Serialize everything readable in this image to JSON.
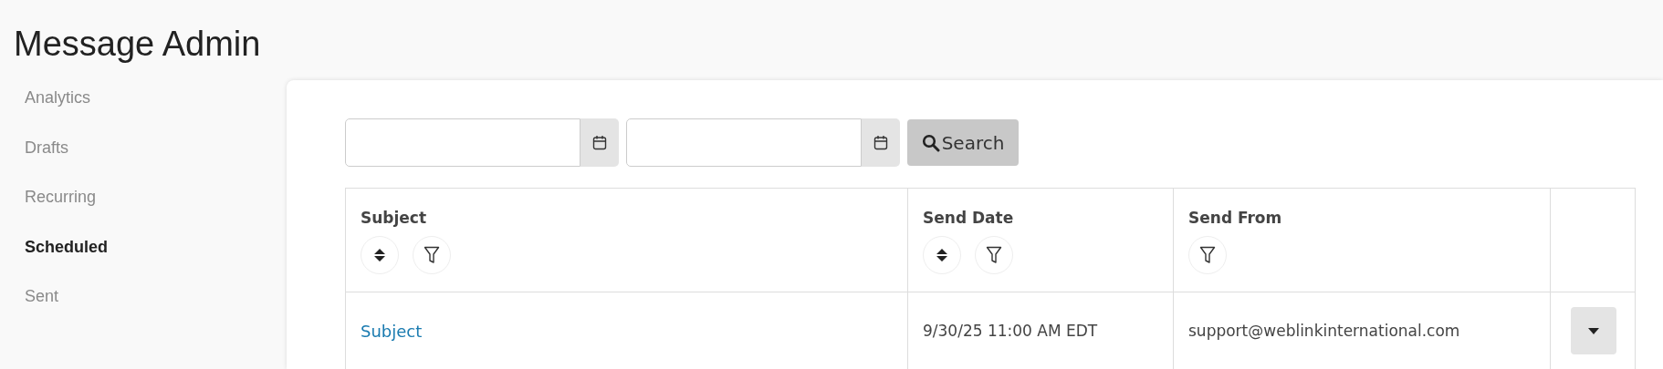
{
  "page": {
    "title": "Message Admin"
  },
  "sidebar": {
    "items": [
      {
        "label": "Analytics",
        "selected": false
      },
      {
        "label": "Drafts",
        "selected": false
      },
      {
        "label": "Recurring",
        "selected": false
      },
      {
        "label": "Scheduled",
        "selected": true
      },
      {
        "label": "Sent",
        "selected": false
      }
    ]
  },
  "filters": {
    "search_button": "Search"
  },
  "table": {
    "columns": [
      {
        "label": "Subject",
        "sortable": true,
        "filterable": true
      },
      {
        "label": "Send Date",
        "sortable": true,
        "filterable": true
      },
      {
        "label": "Send From",
        "sortable": false,
        "filterable": true
      }
    ],
    "rows": [
      {
        "subject": "Subject",
        "send_date": "9/30/25 11:00 AM EDT",
        "send_from": "support@weblinkinternational.com"
      }
    ]
  }
}
